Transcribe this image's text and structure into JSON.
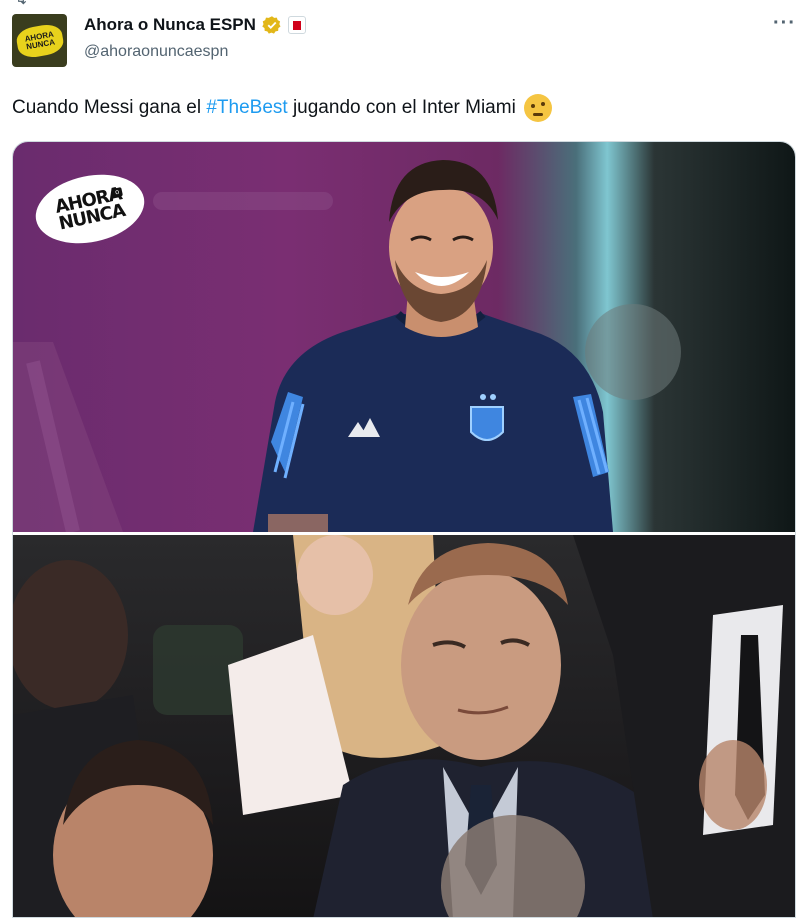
{
  "repost": {
    "label": ""
  },
  "author": {
    "display_name": "Ahora o Nunca ESPN",
    "handle": "@ahoraonuncaespn",
    "avatar_text": "AHORA NUNCA"
  },
  "tweet": {
    "text_before": "Cuando Messi gana el ",
    "hashtag": "#TheBest",
    "text_after": " jugando con el Inter Miami",
    "emoji": "face-with-raised-eyebrow"
  },
  "media": {
    "top_logo_line1": "AHORA",
    "top_logo_line2": "NUNCA",
    "top_logo_tag": "o"
  },
  "colors": {
    "hashtag": "#1d9bf0",
    "handle": "#536471",
    "verified": "#e2b719",
    "jersey": "#1b2b57",
    "stripe": "#3f86e0"
  },
  "icons": [
    "repost-icon",
    "verified-badge-icon",
    "affiliate-badge-icon",
    "more-options-icon"
  ]
}
